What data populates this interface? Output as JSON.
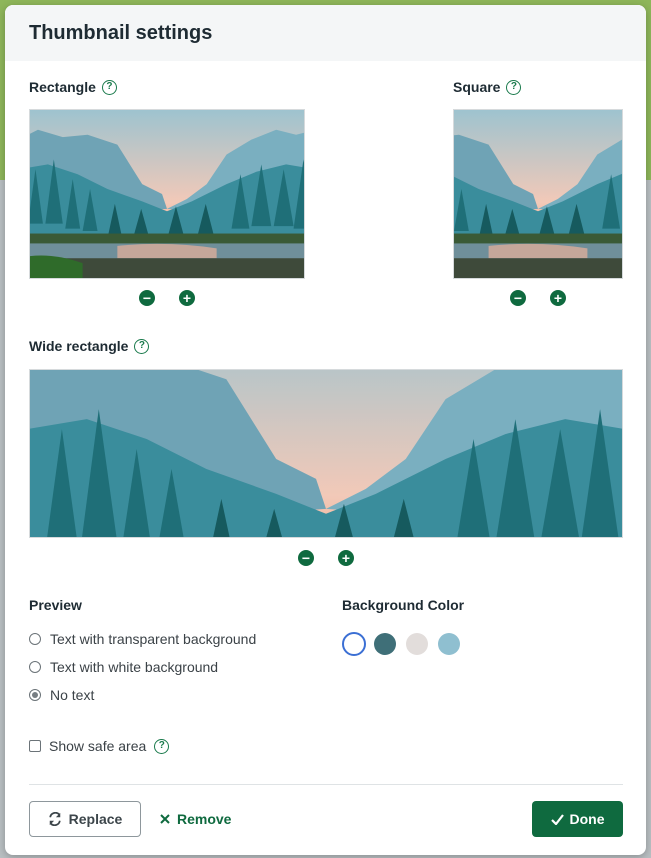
{
  "dialog": {
    "title": "Thumbnail settings"
  },
  "sections": {
    "rectangle": {
      "label": "Rectangle"
    },
    "square": {
      "label": "Square"
    },
    "wide": {
      "label": "Wide rectangle"
    }
  },
  "help_icon_glyph": "?",
  "zoom": {
    "minus": "−",
    "plus": "+"
  },
  "preview": {
    "label": "Preview",
    "options": [
      {
        "label": "Text with transparent background",
        "checked": false
      },
      {
        "label": "Text with white background",
        "checked": false
      },
      {
        "label": "No text",
        "checked": true
      }
    ]
  },
  "background_color": {
    "label": "Background Color",
    "swatches": [
      {
        "name": "white",
        "color": "#ffffff",
        "selected": true
      },
      {
        "name": "dark-teal",
        "color": "#3f6f78",
        "selected": false
      },
      {
        "name": "light-gray",
        "color": "#e2dddb",
        "selected": false
      },
      {
        "name": "light-blue",
        "color": "#8fbfd0",
        "selected": false
      }
    ]
  },
  "safe_area": {
    "label": "Show safe area",
    "checked": false
  },
  "buttons": {
    "replace": "Replace",
    "remove": "Remove",
    "done": "Done"
  },
  "icons": {
    "replace": "refresh-icon",
    "remove": "close-icon",
    "done": "check-icon",
    "help": "help-circle-icon"
  },
  "colors": {
    "accent": "#0f6a3f",
    "selected_ring": "#3b6fd4"
  }
}
